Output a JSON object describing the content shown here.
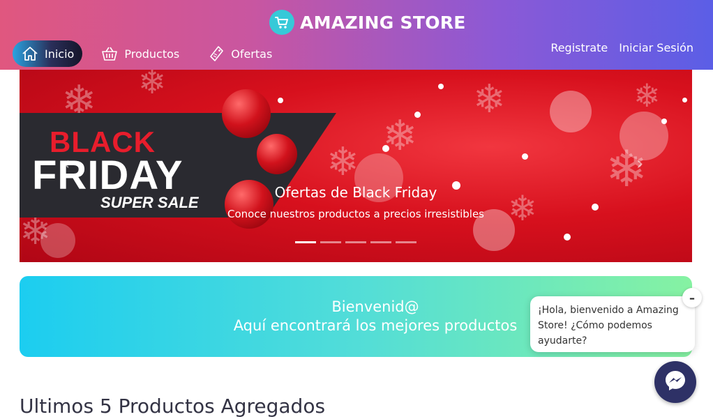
{
  "brand": {
    "title": "AMAZING STORE",
    "icon": "shopping-cart-icon",
    "icon_color": "#36c9d8"
  },
  "nav": {
    "items": [
      {
        "label": "Inicio",
        "icon": "home-icon",
        "active": true
      },
      {
        "label": "Productos",
        "icon": "basket-icon",
        "active": false
      },
      {
        "label": "Ofertas",
        "icon": "tag-icon",
        "active": false
      }
    ],
    "register": "Registrate",
    "login": "Iniciar Sesión"
  },
  "carousel": {
    "banner_black": "BLACK",
    "banner_friday": "FRIDAY",
    "banner_sale": "SUPER SALE",
    "caption_title": "Ofertas de Black Friday",
    "caption_text": "Conoce nuestros productos a precios irresistibles",
    "slide_count": 5,
    "active_slide": 1,
    "prev": "‹",
    "next": "›"
  },
  "welcome": {
    "line1": "Bienvenid@",
    "line2": "Aquí encontrará los mejores productos"
  },
  "section_title": "Ultimos 5 Productos Agregados",
  "chat": {
    "message": "¡Hola, bienvenido a Amazing Store! ¿Cómo podemos ayudarte?",
    "minimize": "–",
    "button_icon": "messenger-icon"
  },
  "colors": {
    "header_start": "#e0577f",
    "header_end": "#5b5ee6",
    "welcome_start": "#1ccdf0",
    "welcome_end": "#86f2a2",
    "black_friday_red": "#e81d2c"
  }
}
